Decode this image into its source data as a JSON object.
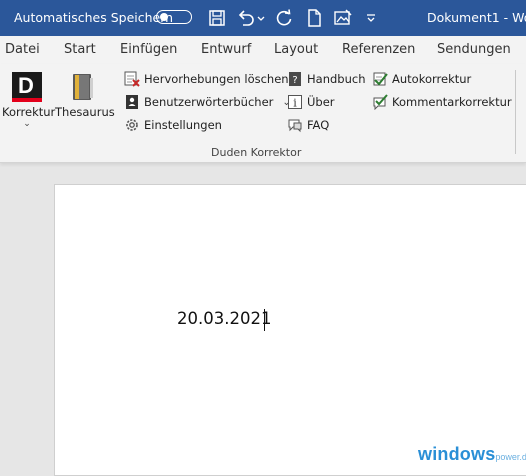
{
  "titlebar": {
    "autosave_label": "Automatisches Speichern",
    "doc_title": "Dokument1 - Wo"
  },
  "tabs": [
    {
      "label": "Datei"
    },
    {
      "label": "Start"
    },
    {
      "label": "Einfügen"
    },
    {
      "label": "Entwurf"
    },
    {
      "label": "Layout"
    },
    {
      "label": "Referenzen"
    },
    {
      "label": "Sendungen"
    }
  ],
  "ribbon": {
    "korrektur_label": "Korrektur",
    "thesaurus_label": "Thesaurus",
    "hervorhebungen_label": "Hervorhebungen löschen",
    "benutzer_label": "Benutzerwörterbücher",
    "einstellungen_label": "Einstellungen",
    "handbuch_label": "Handbuch",
    "ueber_label": "Über",
    "faq_label": "FAQ",
    "autokorrektur_label": "Autokorrektur",
    "kommentar_label": "Kommentarkorrektur",
    "group_label": "Duden Korrektor",
    "duden_logo_letter": "D"
  },
  "document": {
    "date_text": "20.03.2021"
  },
  "watermark": {
    "main": "windows",
    "sub": "power.de"
  },
  "colors": {
    "titlebar": "#2b579a",
    "watermark": "#2a8fd6"
  }
}
